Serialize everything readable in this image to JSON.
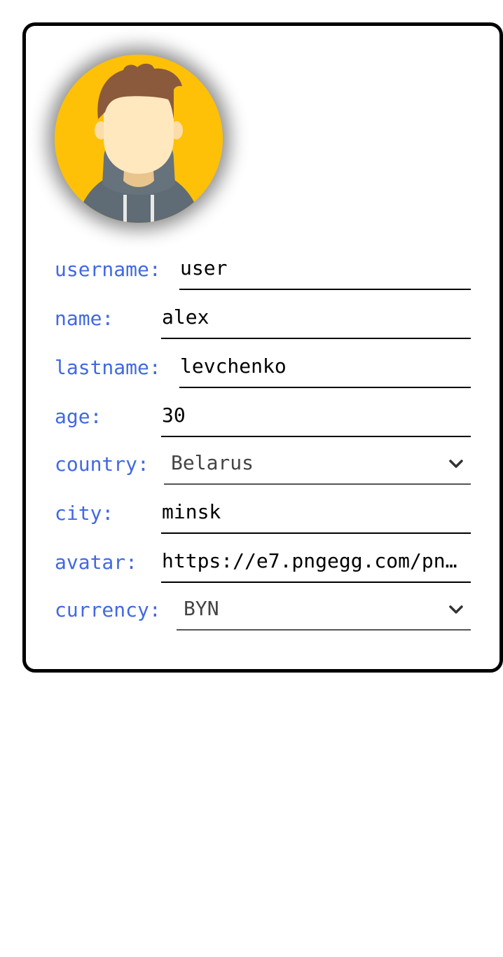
{
  "profile": {
    "fields": {
      "username": {
        "label": "username:",
        "value": "user"
      },
      "name": {
        "label": "name:",
        "value": "alex"
      },
      "lastname": {
        "label": "lastname:",
        "value": "levchenko"
      },
      "age": {
        "label": "age:",
        "value": "30"
      },
      "country": {
        "label": "country:",
        "value": "Belarus"
      },
      "city": {
        "label": "city:",
        "value": "minsk"
      },
      "avatar": {
        "label": "avatar:",
        "value": "https://e7.pngegg.com/pn…"
      },
      "currency": {
        "label": "currency:",
        "value": "BYN"
      }
    },
    "avatar_icon": "user-avatar-icon",
    "dropdown_icon": "chevron-down-icon"
  },
  "colors": {
    "label": "#4169E1",
    "avatar_background": "#FFC107",
    "border": "#000000"
  }
}
